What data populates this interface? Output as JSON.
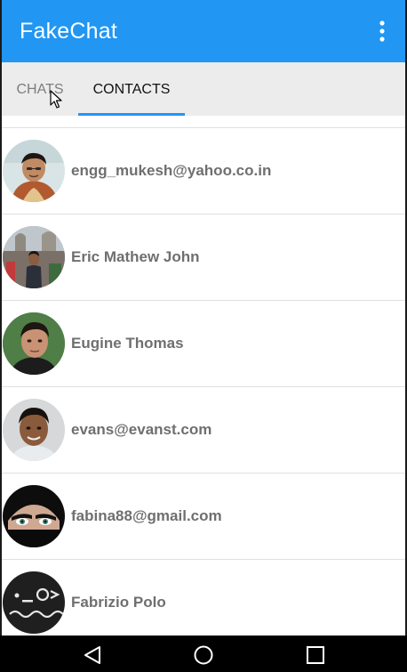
{
  "app": {
    "title": "FakeChat"
  },
  "colors": {
    "app_bar": "#2196f3",
    "tab_indicator": "#2196f3",
    "tab_bar": "#ececec",
    "nav_bar": "#000000"
  },
  "tabs": [
    {
      "label": "CHATS",
      "selected": false
    },
    {
      "label": "CONTACTS",
      "selected": true
    }
  ],
  "contacts": [
    {
      "name": "engg_mukesh@yahoo.co.in",
      "avatar": "avatar-photo"
    },
    {
      "name": "Eric Mathew John",
      "avatar": "avatar-photo"
    },
    {
      "name": "Eugine Thomas",
      "avatar": "avatar-photo"
    },
    {
      "name": "evans@evanst.com",
      "avatar": "avatar-photo"
    },
    {
      "name": "fabina88@gmail.com",
      "avatar": "avatar-photo"
    },
    {
      "name": "Fabrizio Polo",
      "avatar": "avatar-photo"
    }
  ],
  "icons": {
    "overflow": "more-vert-icon",
    "back": "back-icon",
    "home": "home-icon",
    "recents": "recents-icon"
  }
}
